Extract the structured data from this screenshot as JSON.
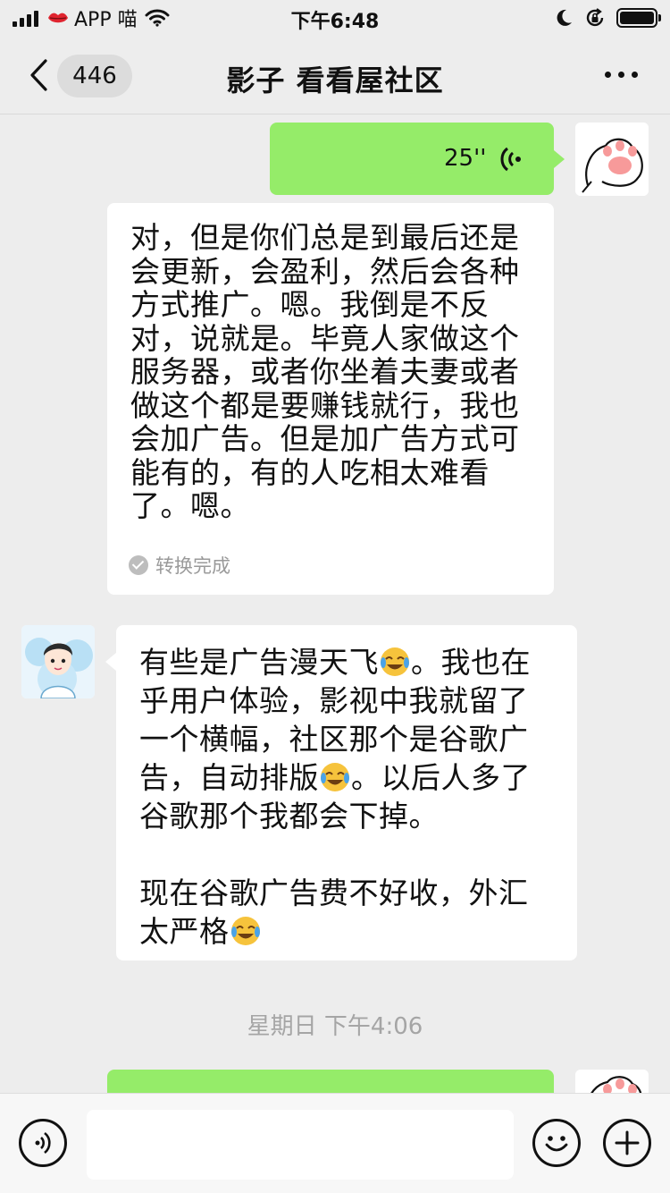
{
  "status_bar": {
    "carrier": "APP 喵",
    "time": "下午6:48"
  },
  "nav": {
    "unread_badge": "446",
    "title": "影子  看看屋社区"
  },
  "messages": {
    "voice": {
      "duration": "25''"
    },
    "transcript": {
      "lines": [
        "对，但是你们总是到最后还是",
        "会更新，会盈利，然后会各种",
        "方式推广。嗯。我倒是不反",
        "对，说就是。毕竟人家做这个",
        "服务器，或者你坐着夫妻或者",
        "做这个都是要赚钱就行，我也",
        "会加广告。但是加广告方式可",
        "能有的，有的人吃相太难看",
        "了。嗯。"
      ],
      "status": "转换完成"
    },
    "reply": {
      "line1_a": "有些是广告漫天飞",
      "line1_b": "。我也在",
      "line2": "乎用户体验，影视中我就留了",
      "line3": "一个横幅，社区那个是谷歌广",
      "line4_a": "告，自动排版",
      "line4_b": "。以后人多了",
      "line5": "谷歌那个我都会下掉。",
      "line6": "现在谷歌广告费不好收，外汇",
      "line7": "太严格"
    },
    "timestamp": "星期日 下午4:06"
  },
  "input": {
    "placeholder": ""
  },
  "colors": {
    "sent_bubble": "#95ec69",
    "received_bubble": "#ffffff",
    "background": "#ededed"
  }
}
